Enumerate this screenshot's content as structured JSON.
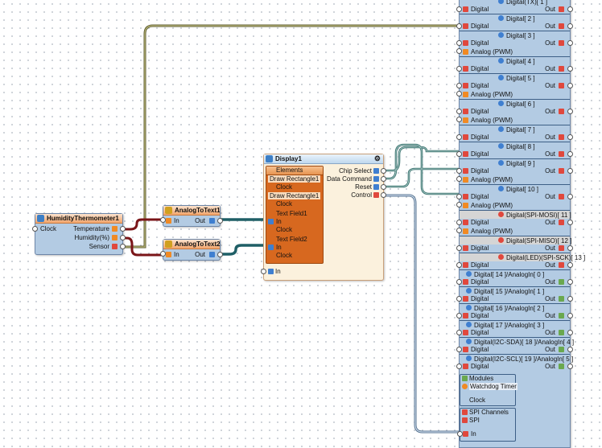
{
  "humidity": {
    "title": "HumidityThermometer1",
    "clock": "Clock",
    "temperature": "Temperature",
    "humidity": "Humidity(%)",
    "sensor": "Sensor"
  },
  "analog1": {
    "title": "AnalogToText1",
    "in": "In",
    "out": "Out"
  },
  "analog2": {
    "title": "AnalogToText2",
    "in": "In",
    "out": "Out"
  },
  "display": {
    "title": "Display1",
    "elements": "Elements",
    "rect1": "Draw Rectangle1",
    "rect2": "Draw Rectangle1",
    "text1": "Text Field1",
    "text2": "Text Field2",
    "in": "In",
    "clock": "Clock",
    "in_bottom": "In",
    "chip_select": "Chip Select",
    "data_command": "Data Command",
    "reset": "Reset",
    "control": "Control"
  },
  "board": {
    "digital": "Digital",
    "analog_pwm": "Analog (PWM)",
    "out": "Out",
    "sections": [
      {
        "title": "Digital(TX)[ 1 ]",
        "pwm": false
      },
      {
        "title": "Digital[ 2 ]",
        "pwm": false
      },
      {
        "title": "Digital[ 3 ]",
        "pwm": true
      },
      {
        "title": "Digital[ 4 ]",
        "pwm": false
      },
      {
        "title": "Digital[ 5 ]",
        "pwm": true
      },
      {
        "title": "Digital[ 6 ]",
        "pwm": true
      },
      {
        "title": "Digital[ 7 ]",
        "pwm": false
      },
      {
        "title": "Digital[ 8 ]",
        "pwm": false
      },
      {
        "title": "Digital[ 9 ]",
        "pwm": true
      },
      {
        "title": "Digital[ 10 ]",
        "pwm": true
      },
      {
        "title": "Digital(SPI-MOSI)[ 11 ]",
        "pwm": true
      },
      {
        "title": "Digital(SPI-MISO)[ 12 ]",
        "pwm": false
      },
      {
        "title": "Digital(LED)(SPI-SCK)[ 13 ]",
        "pwm": false
      },
      {
        "title": "Digital[ 14 ]/AnalogIn[ 0 ]",
        "pwm": false
      },
      {
        "title": "Digital[ 15 ]/AnalogIn[ 1 ]",
        "pwm": false
      },
      {
        "title": "Digital[ 16 ]/AnalogIn[ 2 ]",
        "pwm": false
      },
      {
        "title": "Digital[ 17 ]/AnalogIn[ 3 ]",
        "pwm": false
      },
      {
        "title": "Digital(I2C-SDA)[ 18 ]/AnalogIn[ 4 ]",
        "pwm": false
      },
      {
        "title": "Digital(I2C-SCL)[ 19 ]/AnalogIn[ 5 ]",
        "pwm": false
      }
    ],
    "modules": "Modules",
    "watchdog": "Watchdog Timer",
    "clock": "Clock",
    "spi_channels": "SPI Channels",
    "spi": "SPI",
    "in": "In"
  },
  "colors": {
    "wire_green": "#2f6f6a",
    "wire_red": "#a0272a",
    "wire_olive": "#8c8a4e",
    "wire_blue": "#7f98b4",
    "comp": "#b3cbe3"
  }
}
